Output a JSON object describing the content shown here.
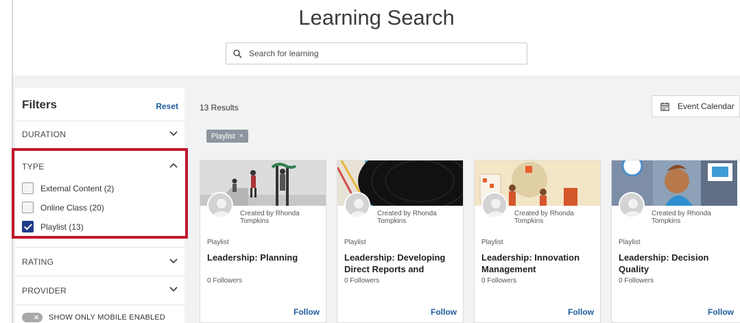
{
  "header": {
    "title": "Learning Search",
    "search_placeholder": "Search for learning"
  },
  "filters": {
    "heading": "Filters",
    "reset_label": "Reset",
    "duration_label": "DURATION",
    "type_label": "TYPE",
    "type_options": [
      {
        "label": "External Content (2)",
        "checked": false
      },
      {
        "label": "Online Class (20)",
        "checked": false
      },
      {
        "label": "Playlist (13)",
        "checked": true
      }
    ],
    "rating_label": "RATING",
    "provider_label": "PROVIDER",
    "mobile_toggle_label": "SHOW ONLY MOBILE ENABLED",
    "highlight_color": "#c0172d"
  },
  "results": {
    "count_label": "13 Results",
    "calendar_label": "Event Calendar",
    "active_chip": "Playlist",
    "chip_close": "×"
  },
  "cards": [
    {
      "creator": "Created by Rhonda Tompkins",
      "type": "Playlist",
      "title": "Leadership: Planning",
      "followers": "0 Followers",
      "follow_label": "Follow"
    },
    {
      "creator": "Created by Rhonda Tompkins",
      "type": "Playlist",
      "title": "Leadership: Developing Direct Reports and",
      "followers": "0 Followers",
      "follow_label": "Follow"
    },
    {
      "creator": "Created by Rhonda Tompkins",
      "type": "Playlist",
      "title": "Leadership: Innovation Management",
      "followers": "0 Followers",
      "follow_label": "Follow"
    },
    {
      "creator": "Created by Rhonda Tompkins",
      "type": "Playlist",
      "title": "Leadership: Decision Quality",
      "followers": "0 Followers",
      "follow_label": "Follow"
    }
  ],
  "colors": {
    "link": "#1f5c9e",
    "checkbox_checked": "#1f3c88",
    "chip": "#8d96a0"
  }
}
